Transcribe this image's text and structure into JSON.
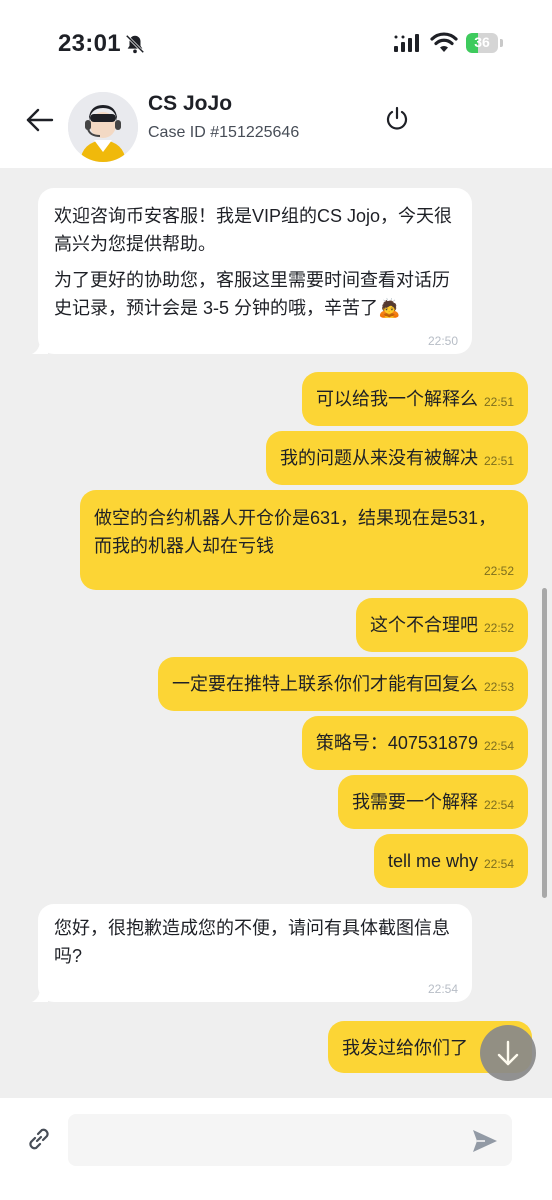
{
  "status_bar": {
    "time": "23:01",
    "battery_level": 36,
    "battery_text": "36",
    "icons": [
      "bell-slash-icon",
      "signal-icon",
      "wifi-icon",
      "battery-icon"
    ]
  },
  "header": {
    "agent_name": "CS JoJo",
    "case_id": "Case ID #151225646",
    "icons": [
      "arrow-left-icon",
      "agent-avatar",
      "power-icon"
    ]
  },
  "colors": {
    "accent": "#fcd535",
    "chat_background": "#efefef",
    "incoming_bubble": "#ffffff",
    "battery_green": "#3ecb5d"
  },
  "messages": [
    {
      "side": "incoming",
      "paragraphs": [
        "欢迎咨询币安客服！我是VIP组的CS Jojo，今天很高兴为您提供帮助。",
        "为了更好的协助您，客服这里需要时间查看对话历史记录，预计会是 3-5 分钟的哦，辛苦了🙇"
      ],
      "time": "22:50"
    },
    {
      "side": "outgoing",
      "text": "可以给我一个解释么",
      "time": "22:51"
    },
    {
      "side": "outgoing",
      "text": "我的问题从来没有被解决",
      "time": "22:51"
    },
    {
      "side": "outgoing",
      "text": "做空的合约机器人开仓价是631，结果现在是531，而我的机器人却在亏钱",
      "time": "22:52"
    },
    {
      "side": "outgoing",
      "text": "这个不合理吧",
      "time": "22:52"
    },
    {
      "side": "outgoing",
      "text": "一定要在推特上联系你们才能有回复么",
      "time": "22:53"
    },
    {
      "side": "outgoing",
      "text": "策略号：407531879",
      "time": "22:54"
    },
    {
      "side": "outgoing",
      "text": "我需要一个解释",
      "time": "22:54"
    },
    {
      "side": "outgoing",
      "text": "tell me why",
      "time": "22:54"
    },
    {
      "side": "incoming",
      "paragraphs": [
        "您好，很抱歉造成您的不便，请问有具体截图信息吗?"
      ],
      "time": "22:54"
    },
    {
      "side": "outgoing",
      "text": "我发过给你们了",
      "time": ""
    }
  ],
  "input": {
    "placeholder": "",
    "value": "",
    "icons": [
      "link-icon",
      "send-icon"
    ]
  },
  "scroll_down_icon": "arrow-down-icon"
}
